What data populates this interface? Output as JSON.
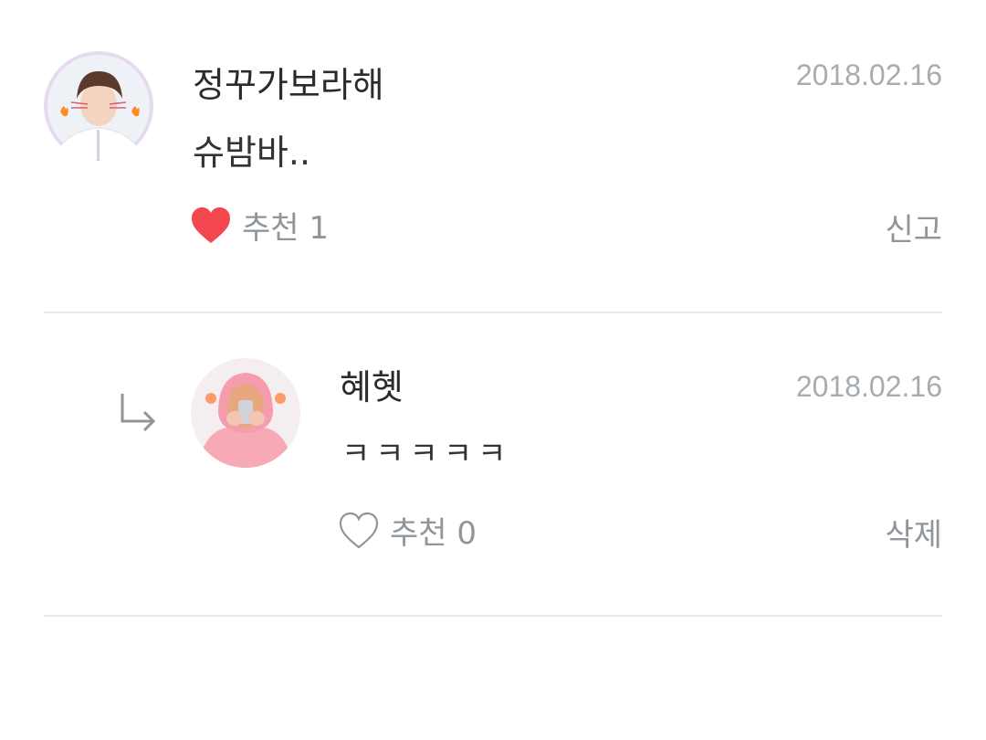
{
  "comments": [
    {
      "author": "정꾸가보라해",
      "date": "2018.02.16",
      "text": "슈밤바..",
      "like_label": "추천",
      "like_count": "1",
      "liked": true,
      "action_label": "신고",
      "avatar_icon": "profile-photo-boy",
      "is_reply": false
    },
    {
      "author": "혜혯",
      "date": "2018.02.16",
      "text": "ㅋㅋㅋㅋㅋ",
      "like_label": "추천",
      "like_count": "0",
      "liked": false,
      "action_label": "삭제",
      "avatar_icon": "profile-photo-pink-hoodie",
      "is_reply": true
    }
  ],
  "colors": {
    "heart_filled": "#f2474f",
    "heart_outline": "#8f959a",
    "divider": "#e7e8ea",
    "muted_text": "#8f959a",
    "date_text": "#a7acb1"
  }
}
